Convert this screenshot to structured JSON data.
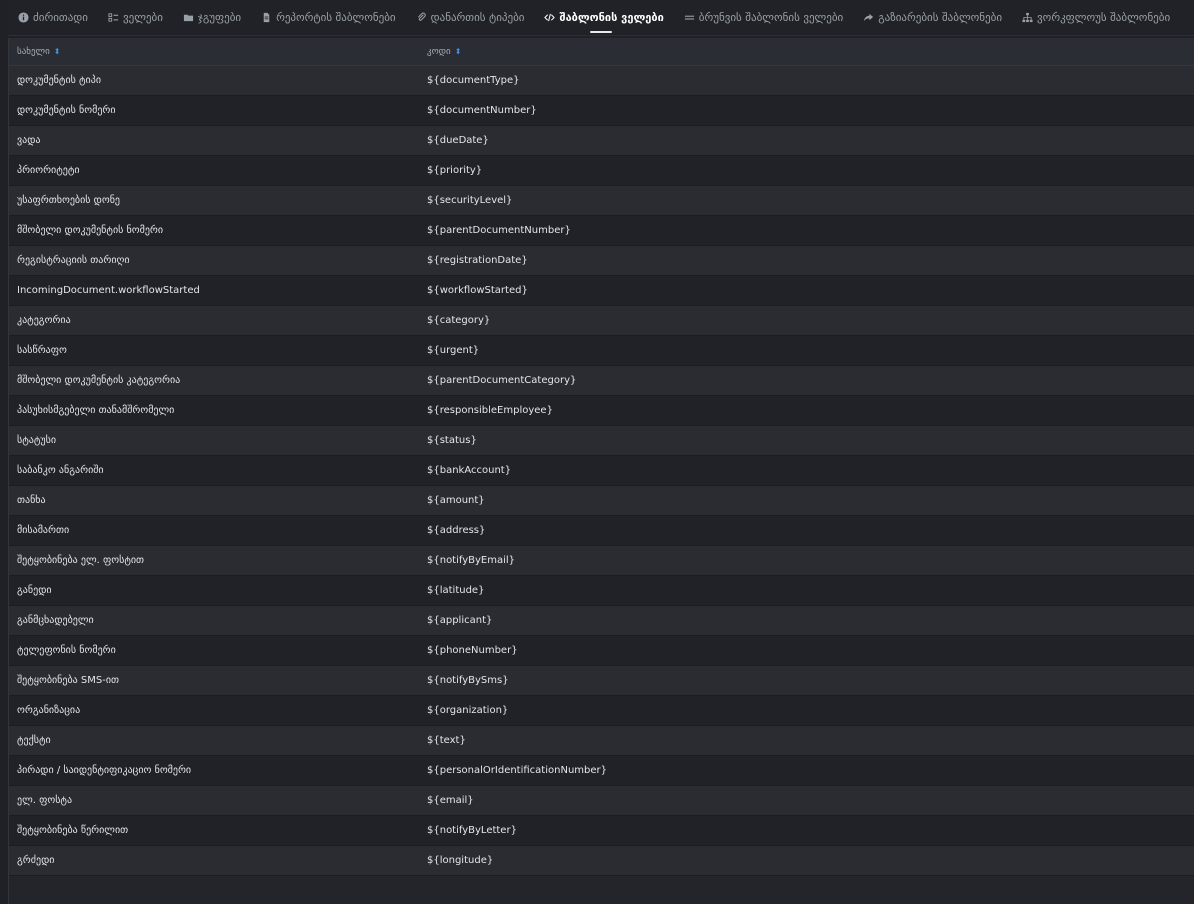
{
  "tabs": [
    {
      "label": "ძირითადი",
      "icon": "info-icon"
    },
    {
      "label": "ველები",
      "icon": "list-icon"
    },
    {
      "label": "ჯგუფები",
      "icon": "folder-icon"
    },
    {
      "label": "რეპორტის შაბლონები",
      "icon": "document-icon"
    },
    {
      "label": "დანართის ტიპები",
      "icon": "paperclip-icon"
    },
    {
      "label": "შაბლონის ველები",
      "icon": "code-icon",
      "active": true
    },
    {
      "label": "ბრუნვის შაბლონის ველები",
      "icon": "lines-icon"
    },
    {
      "label": "გაზიარების შაბლონები",
      "icon": "share-icon"
    },
    {
      "label": "ვორკფლოუს შაბლონები",
      "icon": "sitemap-icon"
    }
  ],
  "table": {
    "columns": [
      "სახელი",
      "კოდი"
    ],
    "rows": [
      [
        "დოკუმენტის ტიპი",
        "${documentType}"
      ],
      [
        "დოკუმენტის ნომერი",
        "${documentNumber}"
      ],
      [
        "ვადა",
        "${dueDate}"
      ],
      [
        "პრიორიტეტი",
        "${priority}"
      ],
      [
        "უსაფრთხოების დონე",
        "${securityLevel}"
      ],
      [
        "მშობელი დოკუმენტის ნომერი",
        "${parentDocumentNumber}"
      ],
      [
        "რეგისტრაციის თარიღი",
        "${registrationDate}"
      ],
      [
        "IncomingDocument.workflowStarted",
        "${workflowStarted}"
      ],
      [
        "კატეგორია",
        "${category}"
      ],
      [
        "სასწრაფო",
        "${urgent}"
      ],
      [
        "მშობელი დოკუმენტის კატეგორია",
        "${parentDocumentCategory}"
      ],
      [
        "პასუხისმგებელი თანამშრომელი",
        "${responsibleEmployee}"
      ],
      [
        "სტატუსი",
        "${status}"
      ],
      [
        "საბანკო ანგარიში",
        "${bankAccount}"
      ],
      [
        "თანხა",
        "${amount}"
      ],
      [
        "მისამართი",
        "${address}"
      ],
      [
        "შეტყობინება ელ. ფოსტით",
        "${notifyByEmail}"
      ],
      [
        "განედი",
        "${latitude}"
      ],
      [
        "განმცხადებელი",
        "${applicant}"
      ],
      [
        "ტელეფონის ნომერი",
        "${phoneNumber}"
      ],
      [
        "შეტყობინება SMS-ით",
        "${notifyBySms}"
      ],
      [
        "ორგანიზაცია",
        "${organization}"
      ],
      [
        "ტექსტი",
        "${text}"
      ],
      [
        "პირადი / საიდენტიფიკაციო ნომერი",
        "${personalOrIdentificationNumber}"
      ],
      [
        "ელ. ფოსტა",
        "${email}"
      ],
      [
        "შეტყობინება წერილით",
        "${notifyByLetter}"
      ],
      [
        "გრძედი",
        "${longitude}"
      ]
    ]
  },
  "colors": {
    "accent": "#3f8ee0",
    "background": "#1f2126"
  }
}
